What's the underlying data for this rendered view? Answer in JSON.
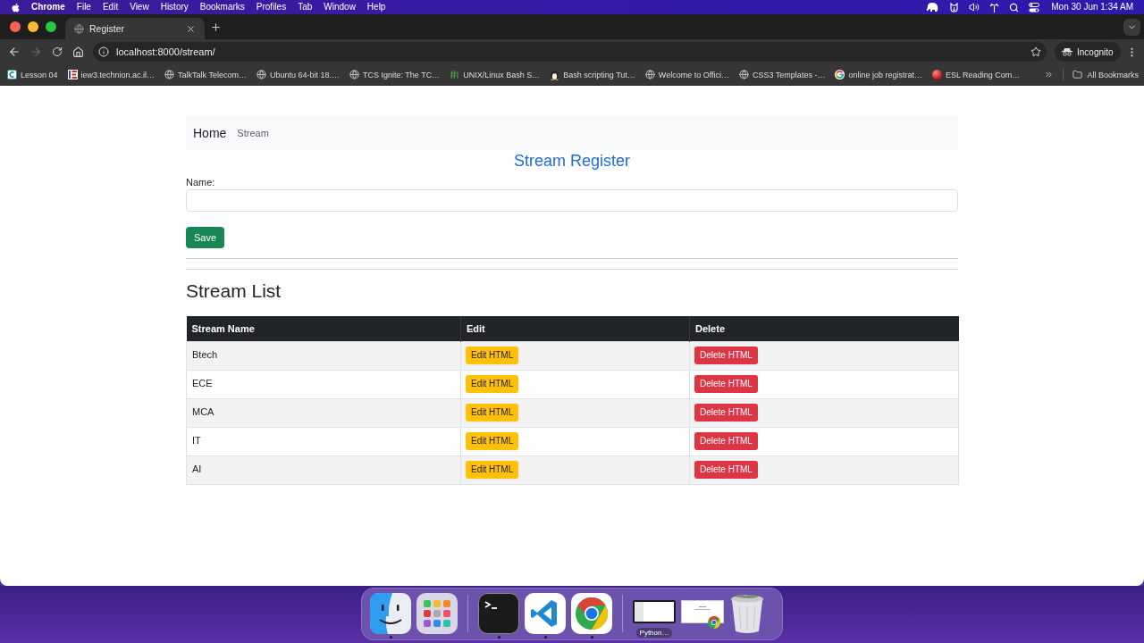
{
  "menu_bar": {
    "app": "Chrome",
    "menus": [
      "File",
      "Edit",
      "View",
      "History",
      "Bookmarks",
      "Profiles",
      "Tab",
      "Window",
      "Help"
    ],
    "clock": "Mon 30 Jun 1:34 AM"
  },
  "browser": {
    "tabs": [
      {
        "title": "Register",
        "selected": true
      }
    ],
    "nav": [
      {
        "kind": "back",
        "disabled": false
      },
      {
        "kind": "forward",
        "disabled": true
      },
      {
        "kind": "reload",
        "disabled": false
      },
      {
        "kind": "home",
        "disabled": false
      }
    ],
    "url": "localhost:8000/stream/",
    "profile": "Incognito",
    "bookmarks": [
      {
        "kind": "tile",
        "label": "Lesson 04"
      },
      {
        "kind": "stripes",
        "label": "iew3.technion.ac.il…"
      },
      {
        "kind": "globe",
        "label": "TalkTalk Telecom…"
      },
      {
        "kind": "globe",
        "label": "Ubuntu 64-bit 18.…"
      },
      {
        "kind": "globe",
        "label": "TCS Ignite: The TC…"
      },
      {
        "kind": "hash",
        "label": "UNIX/Linux Bash S…"
      },
      {
        "kind": "penguin",
        "label": "Bash scripting Tut…"
      },
      {
        "kind": "globe",
        "label": "Welcome to Offici…"
      },
      {
        "kind": "globe",
        "label": "CSS3 Templates -…"
      },
      {
        "kind": "ring",
        "label": "online job registrat…"
      },
      {
        "kind": "ball",
        "label": "ESL Reading Com…"
      }
    ],
    "all_bookmarks": "All Bookmarks"
  },
  "page": {
    "navbar": {
      "brand": "Home",
      "links": [
        "Stream"
      ]
    },
    "title": "Stream Register",
    "form": {
      "label": "Name:",
      "save": "Save"
    },
    "list_title": "Stream List",
    "table": {
      "columns": [
        "Stream Name",
        "Edit",
        "Delete"
      ],
      "rows": [
        {
          "name": "Btech",
          "edit": "Edit HTML",
          "delete": "Delete HTML"
        },
        {
          "name": "ECE",
          "edit": "Edit HTML",
          "delete": "Delete HTML"
        },
        {
          "name": "MCA",
          "edit": "Edit HTML",
          "delete": "Delete HTML"
        },
        {
          "name": "IT",
          "edit": "Edit HTML",
          "delete": "Delete HTML"
        },
        {
          "name": "AI",
          "edit": "Edit HTML",
          "delete": "Delete HTML"
        }
      ]
    }
  },
  "dock": {
    "items": [
      {
        "kind": "finder",
        "running": true
      },
      {
        "kind": "launchpad",
        "running": false
      },
      {
        "kind": "terminal",
        "running": true
      },
      {
        "kind": "editor",
        "running": true
      },
      {
        "kind": "browser",
        "running": true
      },
      {
        "kind": "window",
        "label": "Python…"
      },
      {
        "kind": "window-browser"
      },
      {
        "kind": "trash"
      }
    ]
  }
}
